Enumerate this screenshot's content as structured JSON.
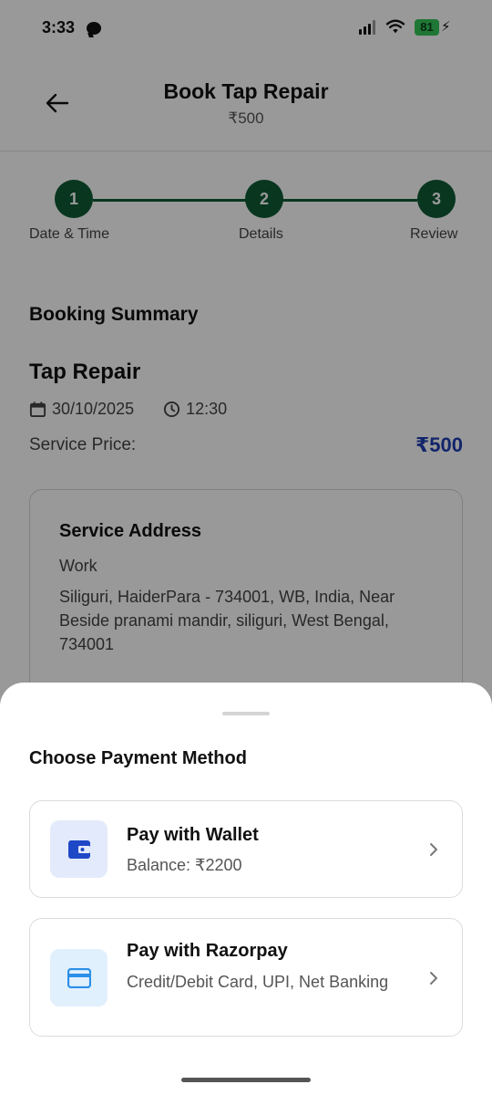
{
  "status_bar": {
    "time": "3:33",
    "battery": "81"
  },
  "header": {
    "title": "Book Tap Repair",
    "subtitle": "₹500",
    "back_icon": "arrow-left-icon"
  },
  "stepper": {
    "steps": [
      {
        "number": "1",
        "label": "Date & Time"
      },
      {
        "number": "2",
        "label": "Details"
      },
      {
        "number": "3",
        "label": "Review"
      }
    ],
    "color": "#0e5a34"
  },
  "summary": {
    "title": "Booking Summary",
    "service_name": "Tap Repair",
    "date": "30/10/2025",
    "time": "12:30",
    "price_label": "Service Price:",
    "price": "₹500",
    "price_color": "#1f3fb3"
  },
  "address": {
    "title": "Service Address",
    "type": "Work",
    "text": "Siliguri, HaiderPara - 734001, WB, India, Near Beside pranami mandir, siliguri, West Bengal, 734001"
  },
  "payment_sheet": {
    "title": "Choose Payment Method",
    "options": [
      {
        "title": "Pay with Wallet",
        "subtitle": "Balance: ₹2200",
        "icon": "wallet-icon"
      },
      {
        "title": "Pay with Razorpay",
        "subtitle": "Credit/Debit Card, UPI, Net Banking",
        "icon": "credit-card-icon"
      }
    ]
  }
}
